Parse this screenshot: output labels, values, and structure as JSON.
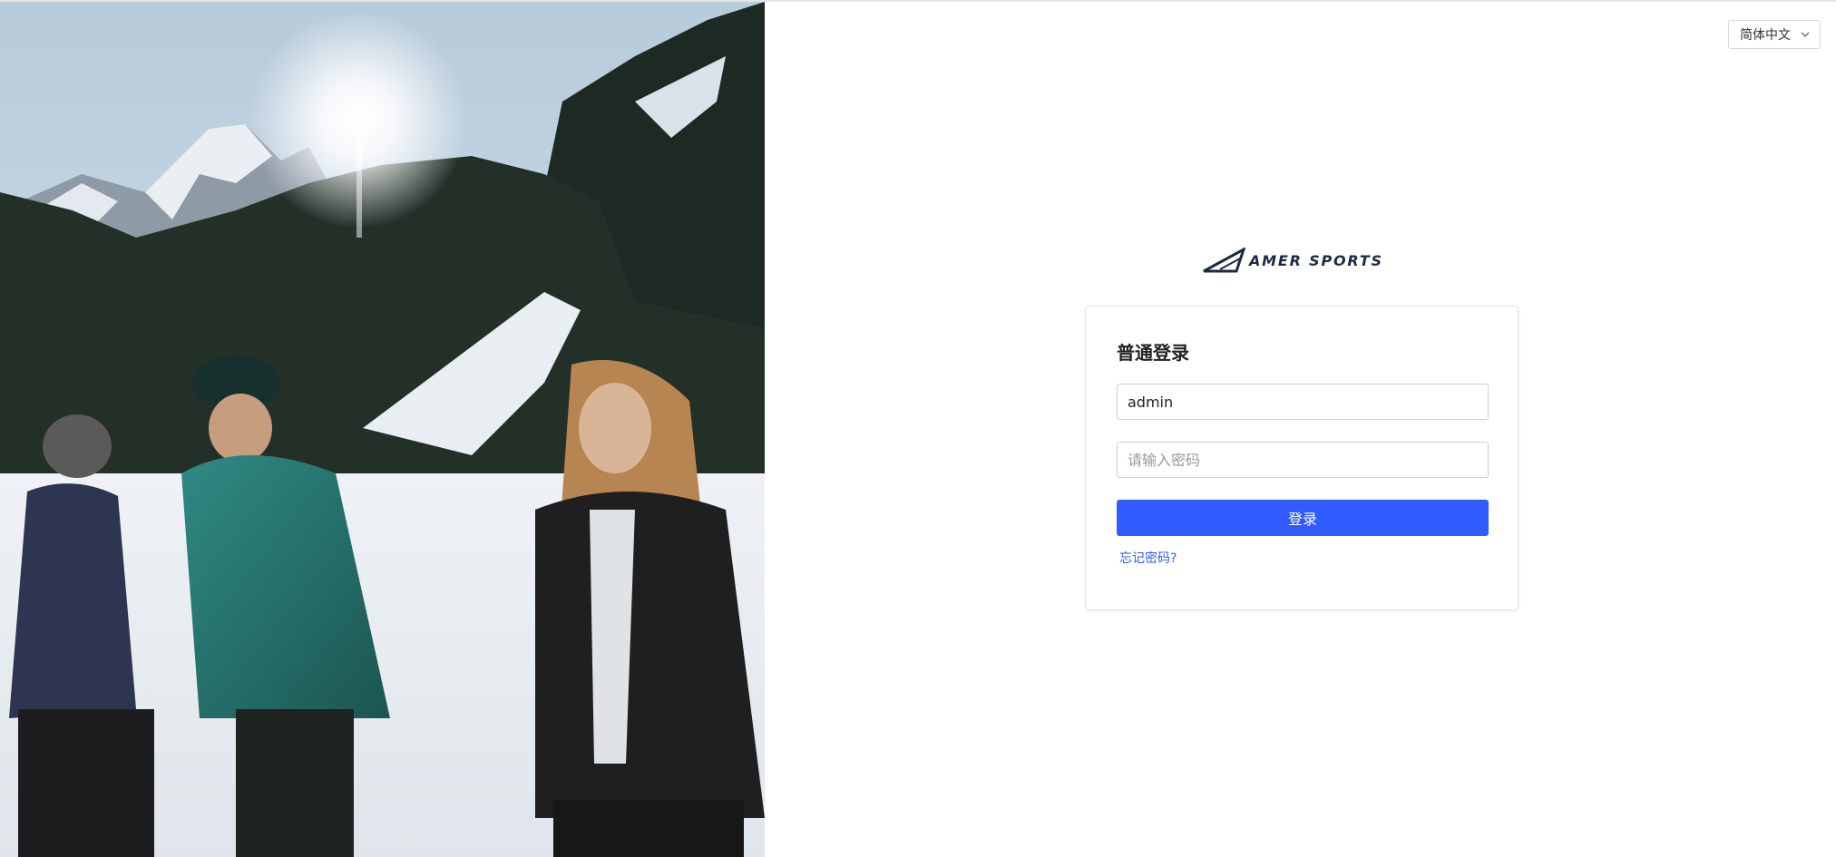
{
  "language": {
    "selected": "简体中文"
  },
  "brand": {
    "name": "AMER SPORTS",
    "color": "#1c2a44"
  },
  "login": {
    "title": "普通登录",
    "username_value": "admin",
    "password_placeholder": "请输入密码",
    "submit_label": "登录",
    "forgot_label": "忘记密码?"
  },
  "colors": {
    "accent": "#2f5bff"
  },
  "icons": {
    "language_dropdown": "chevron-down-icon"
  }
}
